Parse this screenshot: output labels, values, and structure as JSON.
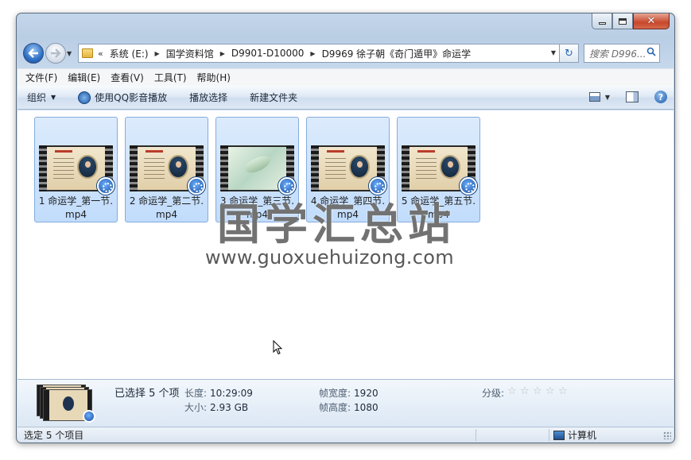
{
  "window": {
    "caption": {
      "minimize": "—",
      "maximize": "□",
      "close": "✕"
    }
  },
  "nav": {
    "back_icon": "back-arrow-icon",
    "forward_icon": "forward-arrow-icon",
    "refresh_glyph": "↻",
    "breadcrumb_overflow": "«",
    "breadcrumbs": [
      "系统 (E:)",
      "国学资料馆",
      "D9901-D10000",
      "D9969 徐子朝《奇门遁甲》命运学"
    ],
    "search_placeholder": "搜索 D996..."
  },
  "menu": [
    "文件(F)",
    "编辑(E)",
    "查看(V)",
    "工具(T)",
    "帮助(H)"
  ],
  "command_bar": {
    "organize": "组织",
    "play_qq": "使用QQ影音播放",
    "play_selection": "播放选择",
    "new_folder": "新建文件夹",
    "help": "?"
  },
  "files": [
    {
      "name": "1 命运学_第一节.mp4",
      "thumb": "lecture"
    },
    {
      "name": "2 命运学_第二节.mp4",
      "thumb": "lecture"
    },
    {
      "name": "3 命运学_第三节.mp4",
      "thumb": "koi"
    },
    {
      "name": "4 命运学_第四节.mp4",
      "thumb": "lecture"
    },
    {
      "name": "5 命运学_第五节.mp4",
      "thumb": "lecture"
    }
  ],
  "watermark": {
    "chinese": "国学汇总站",
    "url": "www.guoxuehuizong.com"
  },
  "details": {
    "selected": "已选择 5 个项",
    "length_label": "长度:",
    "length_value": "10:29:09",
    "size_label": "大小:",
    "size_value": "2.93 GB",
    "frame_width_label": "帧宽度:",
    "frame_width_value": "1920",
    "frame_height_label": "帧高度:",
    "frame_height_value": "1080",
    "rating_label": "分级:",
    "rating_stars": 0
  },
  "status": {
    "left": "选定 5 个项目",
    "right": "计算机"
  },
  "colors": {
    "accent": "#2e6fc3",
    "selection": "#c1dcfc"
  }
}
